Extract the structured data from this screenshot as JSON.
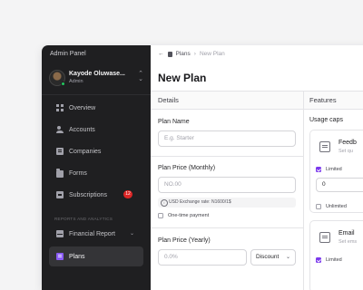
{
  "sidebar": {
    "panel_title": "Admin Panel",
    "user": {
      "name": "Kayode Oluwase...",
      "role": "Admin"
    },
    "items": [
      {
        "label": "Overview",
        "icon": "grid-icon"
      },
      {
        "label": "Accounts",
        "icon": "users-icon"
      },
      {
        "label": "Companies",
        "icon": "building-icon"
      },
      {
        "label": "Forms",
        "icon": "folder-icon"
      },
      {
        "label": "Subscriptions",
        "icon": "inbox-icon",
        "badge": "12"
      }
    ],
    "section_label": "REPORTS AND ANALYTICS",
    "report_items": [
      {
        "label": "Financial Report",
        "icon": "report-icon"
      },
      {
        "label": "Plans",
        "icon": "plans-icon",
        "active": true
      }
    ]
  },
  "breadcrumb": {
    "parent": "Plans",
    "current": "New Plan"
  },
  "page_title": "New Plan",
  "details": {
    "heading": "Details",
    "plan_name": {
      "label": "Plan Name",
      "placeholder": "E.g. Starter"
    },
    "price_monthly": {
      "label": "Plan Price (Monthly)",
      "placeholder": "NO.00",
      "exchange_note": "USD Exchange rate: N1600/1$",
      "one_time_label": "One-time payment"
    },
    "price_yearly": {
      "label": "Plan Price (Yearly)",
      "placeholder": "0.0%",
      "discount_label": "Discount"
    }
  },
  "features": {
    "heading": "Features",
    "usage_caps": "Usage caps",
    "cards": [
      {
        "title": "Feedb",
        "subtitle": "Set qu",
        "limited_label": "Limited",
        "value": "0",
        "unlimited_label": "Unlimited"
      },
      {
        "title": "Email",
        "subtitle": "Set ems",
        "limited_label": "Limited"
      }
    ]
  },
  "colors": {
    "accent": "#7c3aed",
    "sidebar_bg": "#1f1f21",
    "badge": "#dc2626",
    "status_online": "#22c55e"
  }
}
